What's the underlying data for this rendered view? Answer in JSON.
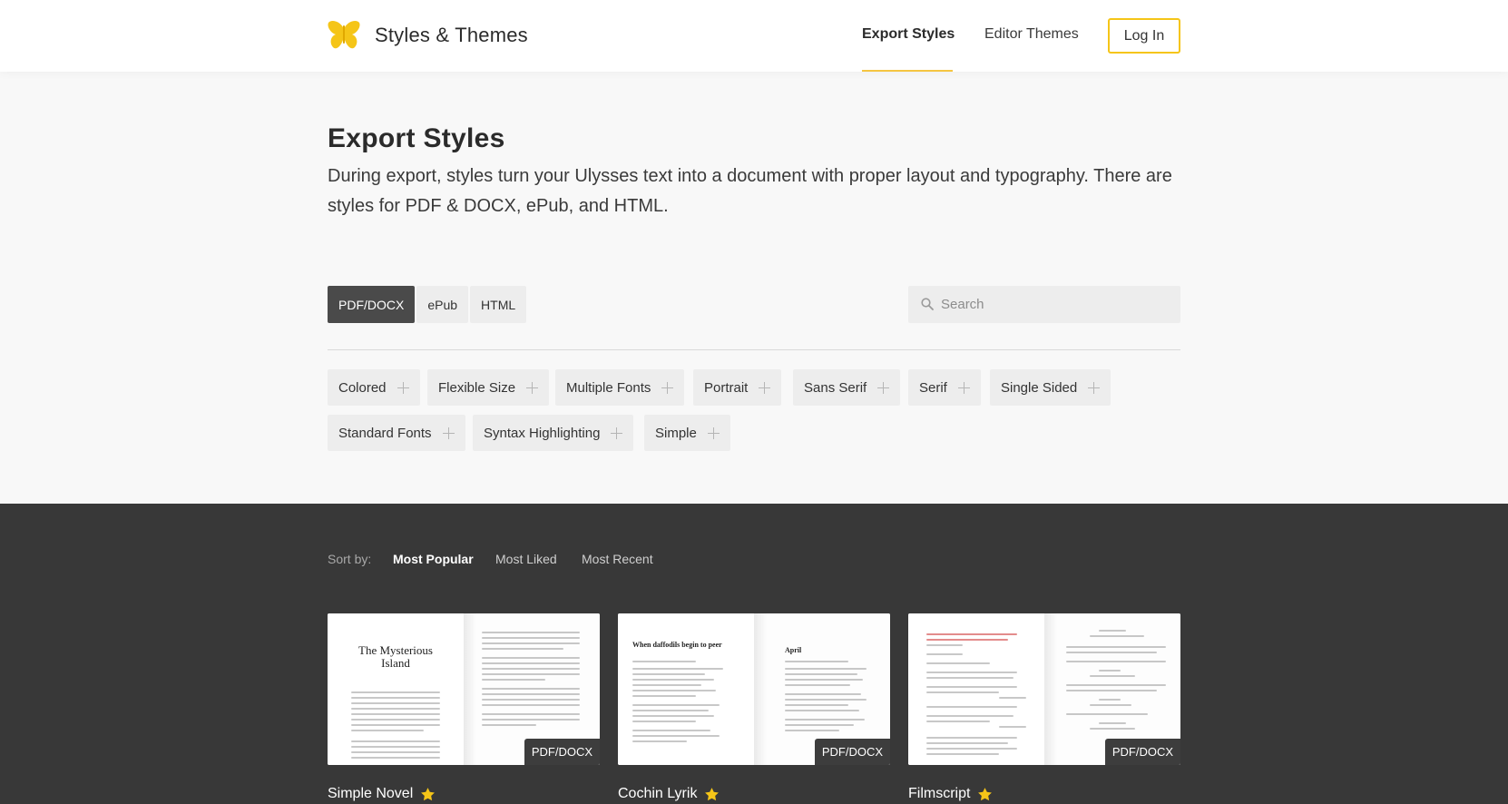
{
  "header": {
    "site_title": "Styles & Themes",
    "logo_icon": "butterfly-icon",
    "nav": [
      {
        "label": "Export Styles",
        "active": true
      },
      {
        "label": "Editor Themes",
        "active": false
      }
    ],
    "login_label": "Log In",
    "accent_color": "#f5c518"
  },
  "intro": {
    "title": "Export Styles",
    "description": "During export, styles turn your Ulysses text into a document with proper layout and typography. There are styles for PDF & DOCX, ePub, and HTML."
  },
  "format_tabs": [
    {
      "label": "PDF/DOCX",
      "active": true
    },
    {
      "label": "ePub",
      "active": false
    },
    {
      "label": "HTML",
      "active": false
    }
  ],
  "search": {
    "placeholder": "Search",
    "value": ""
  },
  "tags": [
    "Colored",
    "Flexible Size",
    "Multiple Fonts",
    "Portrait",
    "Sans Serif",
    "Serif",
    "Single Sided",
    "Standard Fonts",
    "Syntax Highlighting",
    "Simple"
  ],
  "sort": {
    "label": "Sort by:",
    "options": [
      {
        "label": "Most Popular",
        "active": true
      },
      {
        "label": "Most Liked",
        "active": false
      },
      {
        "label": "Most Recent",
        "active": false
      }
    ]
  },
  "cards": [
    {
      "name": "Simple Novel",
      "badge": "PDF/DOCX",
      "preview_title": "The Mysterious Island",
      "starred": true
    },
    {
      "name": "Cochin Lyrik",
      "badge": "PDF/DOCX",
      "preview_title": "When daffodils begin to peer",
      "preview_title_2": "April",
      "starred": true
    },
    {
      "name": "Filmscript",
      "badge": "PDF/DOCX",
      "starred": true
    }
  ],
  "colors": {
    "dark_section": "#383838",
    "star": "#f5c518",
    "active_tab": "#4a4a4a"
  }
}
